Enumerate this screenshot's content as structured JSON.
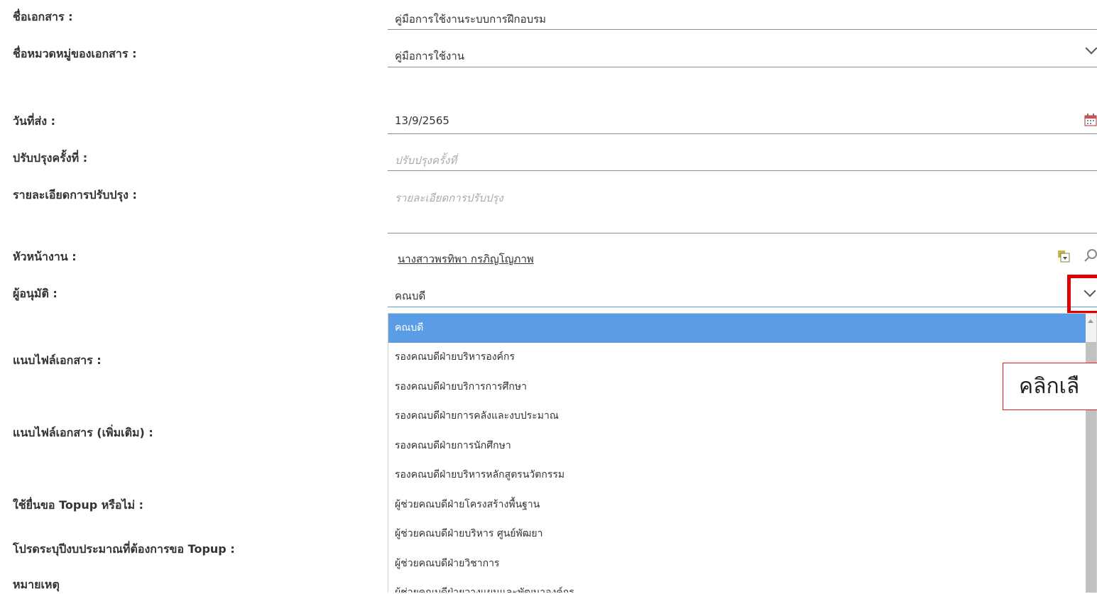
{
  "form": {
    "doc_name": {
      "label": "ชื่อเอกสาร :",
      "value": "คู่มือการใช้งานระบบการฝึกอบรม"
    },
    "category": {
      "label": "ชื่อหมวดหมู่ของเอกสาร :",
      "value": "คู่มือการใช้งาน"
    },
    "send_date": {
      "label": "วันที่ส่ง :",
      "value": "13/9/2565"
    },
    "revision": {
      "label": "ปรับปรุงครั้งที่ :",
      "placeholder": "ปรับปรุงครั้งที่"
    },
    "revision_detail": {
      "label": "รายละเอียดการปรับปรุง :",
      "placeholder": "รายละเอียดการปรับปรุง"
    },
    "supervisor": {
      "label": "หัวหน้างาน :",
      "value": "นางสาวพรทิพา กรภิญโญภาพ"
    },
    "approver": {
      "label": "ผู้อนุมัติ :",
      "value": "คณบดี"
    },
    "attach": {
      "label": "แนบไฟล์เอกสาร :"
    },
    "attach_more": {
      "label": "แนบไฟล์เอกสาร (เพิ่มเติม) :"
    },
    "topup": {
      "label": "ใช้ยื่นขอ Topup หรือไม่ :"
    },
    "topup_year": {
      "label": "โปรดระบุปีงบประมาณที่ต้องการขอ Topup :"
    },
    "note": {
      "label": "หมายเหตุ"
    }
  },
  "dropdown": {
    "options": [
      "คณบดี",
      "รองคณบดีฝ่ายบริหารองค์กร",
      "รองคณบดีฝ่ายบริการการศึกษา",
      "รองคณบดีฝ่ายการคลังและงบประมาณ",
      "รองคณบดีฝ่ายการนักศึกษา",
      "รองคณบดีฝ่ายบริหารหลักสูตรนวัตกรรม",
      "ผู้ช่วยคณบดีฝ่ายโครงสร้างพื้นฐาน",
      "ผู้ช่วยคณบดีฝ่ายบริหาร ศูนย์พัฒยา",
      "ผู้ช่วยคณบดีฝ่ายวิชาการ",
      "ผู้ช่วยคณบดีฝ่ายวางแผนและพัฒนาองค์กร"
    ],
    "selected_index": 0
  },
  "annotation": {
    "text": "คลิกเลื",
    "color": "#e00000"
  },
  "icons": {
    "calendar": "calendar-icon",
    "lookup": "lookup-list-icon",
    "search": "search-icon",
    "chevron": "chevron-down-icon"
  }
}
